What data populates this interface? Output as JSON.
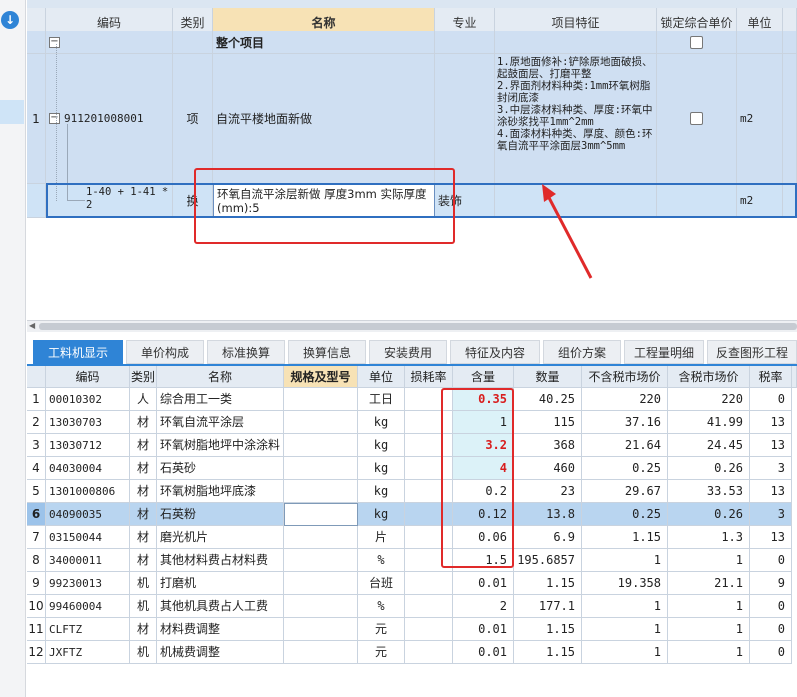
{
  "top_table": {
    "headers": [
      "",
      "编码",
      "类别",
      "名称",
      "专业",
      "项目特征",
      "锁定综合单价",
      "单位"
    ],
    "whole_project_label": "整个项目",
    "main_row": {
      "no": "1",
      "code": "911201008001",
      "type": "项",
      "name": "自流平楼地面新做",
      "feature": "1.原地面修补:铲除原地面破损、起鼓面层、打磨平整\n2.界面剂材料种类:1mm环氧树脂封闭底漆\n3.中层漆材料种类、厚度:环氧中涂砂浆找平1mm^2mm\n4.面漆材料种类、厚度、颜色:环氧自流平平涂面层3mm^5mm",
      "unit": "m2"
    },
    "sub_row": {
      "code": "1-40 + 1-41 * 2",
      "type": "换",
      "name": "环氧自流平涂层新做 厚度3mm  实际厚度(mm):5",
      "specialty": "装饰",
      "unit": "m2"
    }
  },
  "tabs": [
    "工料机显示",
    "单价构成",
    "标准换算",
    "换算信息",
    "安装费用",
    "特征及内容",
    "组价方案",
    "工程量明细",
    "反查图形工程"
  ],
  "bottom_table": {
    "headers": [
      "",
      "编码",
      "类别",
      "名称",
      "规格及型号",
      "单位",
      "损耗率",
      "含量",
      "数量",
      "不含税市场价",
      "含税市场价",
      "税率"
    ],
    "rows": [
      {
        "no": "1",
        "code": "00010302",
        "type": "人",
        "name": "综合用工一类",
        "spec": "",
        "unit": "工日",
        "loss": "",
        "content": "0.35",
        "qty": "40.25",
        "price_ex": "220",
        "price_in": "220",
        "tax": "0"
      },
      {
        "no": "2",
        "code": "13030703",
        "type": "材",
        "name": "环氧自流平涂层",
        "spec": "",
        "unit": "kg",
        "loss": "",
        "content": "1",
        "qty": "115",
        "price_ex": "37.16",
        "price_in": "41.99",
        "tax": "13"
      },
      {
        "no": "3",
        "code": "13030712",
        "type": "材",
        "name": "环氧树脂地坪中涂涂料",
        "spec": "",
        "unit": "kg",
        "loss": "",
        "content": "3.2",
        "qty": "368",
        "price_ex": "21.64",
        "price_in": "24.45",
        "tax": "13"
      },
      {
        "no": "4",
        "code": "04030004",
        "type": "材",
        "name": "石英砂",
        "spec": "",
        "unit": "kg",
        "loss": "",
        "content": "4",
        "qty": "460",
        "price_ex": "0.25",
        "price_in": "0.26",
        "tax": "3"
      },
      {
        "no": "5",
        "code": "1301000806",
        "type": "材",
        "name": "环氧树脂地坪底漆",
        "spec": "",
        "unit": "kg",
        "loss": "",
        "content": "0.2",
        "qty": "23",
        "price_ex": "29.67",
        "price_in": "33.53",
        "tax": "13"
      },
      {
        "no": "6",
        "code": "04090035",
        "type": "材",
        "name": "石英粉",
        "spec": "",
        "unit": "kg",
        "loss": "",
        "content": "0.12",
        "qty": "13.8",
        "price_ex": "0.25",
        "price_in": "0.26",
        "tax": "3"
      },
      {
        "no": "7",
        "code": "03150044",
        "type": "材",
        "name": "磨光机片",
        "spec": "",
        "unit": "片",
        "loss": "",
        "content": "0.06",
        "qty": "6.9",
        "price_ex": "1.15",
        "price_in": "1.3",
        "tax": "13"
      },
      {
        "no": "8",
        "code": "34000011",
        "type": "材",
        "name": "其他材料费占材料费",
        "spec": "",
        "unit": "%",
        "loss": "",
        "content": "1.5",
        "qty": "195.6857",
        "price_ex": "1",
        "price_in": "1",
        "tax": "0"
      },
      {
        "no": "9",
        "code": "99230013",
        "type": "机",
        "name": "打磨机",
        "spec": "",
        "unit": "台班",
        "loss": "",
        "content": "0.01",
        "qty": "1.15",
        "price_ex": "19.358",
        "price_in": "21.1",
        "tax": "9"
      },
      {
        "no": "10",
        "code": "99460004",
        "type": "机",
        "name": "其他机具费占人工费",
        "spec": "",
        "unit": "%",
        "loss": "",
        "content": "2",
        "qty": "177.1",
        "price_ex": "1",
        "price_in": "1",
        "tax": "0"
      },
      {
        "no": "11",
        "code": "CLFTZ",
        "type": "材",
        "name": "材料费调整",
        "spec": "",
        "unit": "元",
        "loss": "",
        "content": "0.01",
        "qty": "1.15",
        "price_ex": "1",
        "price_in": "1",
        "tax": "0"
      },
      {
        "no": "12",
        "code": "JXFTZ",
        "type": "机",
        "name": "机械费调整",
        "spec": "",
        "unit": "元",
        "loss": "",
        "content": "0.01",
        "qty": "1.15",
        "price_ex": "1",
        "price_in": "1",
        "tax": "0"
      }
    ]
  },
  "colors": {
    "accent": "#2f84d6",
    "annotation": "#e02a2a",
    "header_highlight": "#f7e2b5"
  }
}
